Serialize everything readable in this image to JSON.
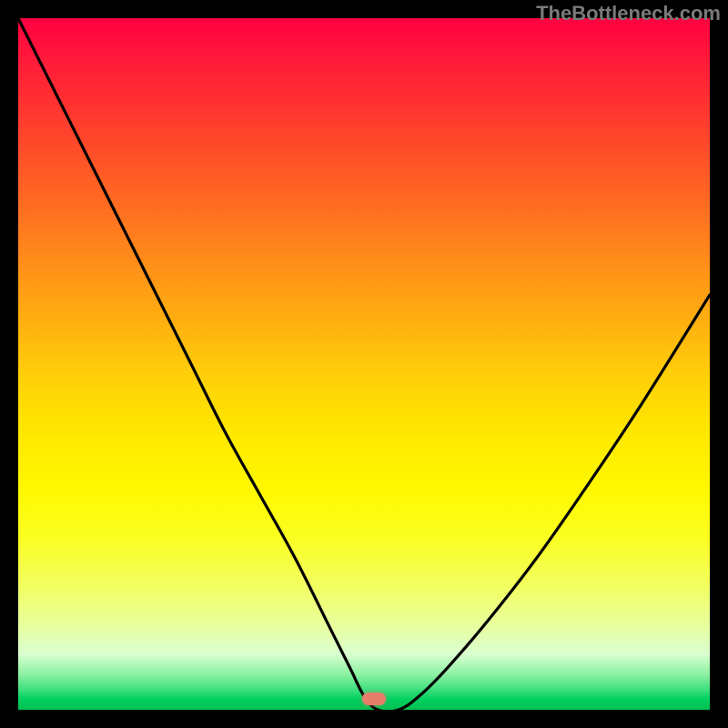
{
  "watermark": {
    "text": "TheBottleneck.com"
  },
  "marker": {
    "x_pct": 51.5,
    "y_pct": 98.4
  },
  "chart_data": {
    "type": "line",
    "title": "",
    "xlabel": "",
    "ylabel": "",
    "xlim": [
      0,
      100
    ],
    "ylim": [
      0,
      100
    ],
    "series": [
      {
        "name": "bottleneck-curve",
        "x": [
          0,
          5,
          10,
          15,
          20,
          25,
          30,
          35,
          40,
          45,
          48,
          50,
          52,
          55,
          58,
          62,
          68,
          75,
          82,
          90,
          100
        ],
        "y": [
          100,
          90,
          80,
          70,
          60,
          50,
          40,
          31,
          22,
          12,
          6,
          2,
          0,
          0,
          2,
          6,
          13,
          22,
          32,
          44,
          60
        ]
      }
    ],
    "annotations": [
      {
        "type": "marker",
        "x": 51.5,
        "y": 1.6,
        "label": "optimal-point"
      }
    ]
  }
}
